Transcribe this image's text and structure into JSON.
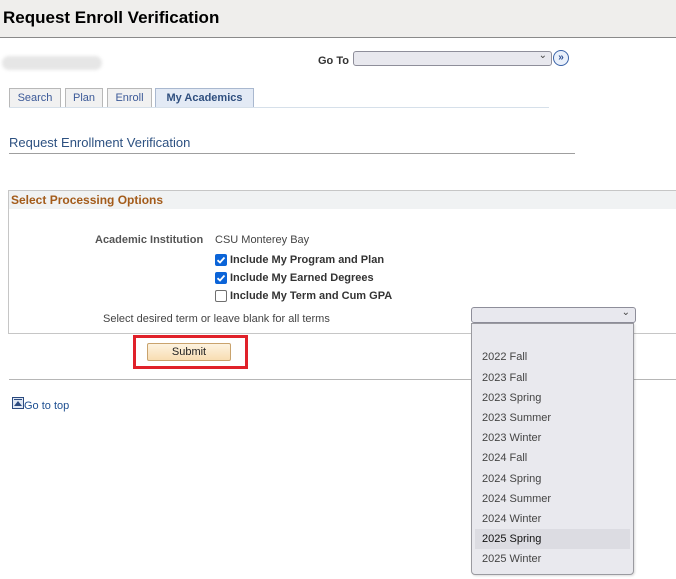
{
  "header": {
    "title": "Request Enroll Verification"
  },
  "goto": {
    "label": "Go To",
    "value": "",
    "go_button": "»"
  },
  "tabs": [
    {
      "label": "Search",
      "active": false
    },
    {
      "label": "Plan",
      "active": false
    },
    {
      "label": "Enroll",
      "active": false
    },
    {
      "label": "My Academics",
      "active": true
    }
  ],
  "page": {
    "section_title": "Request Enrollment Verification",
    "groupbox_title": "Select Processing Options",
    "institution_label": "Academic Institution",
    "institution_value": "CSU Monterey Bay",
    "options": [
      {
        "label": "Include My Program and Plan",
        "checked": true
      },
      {
        "label": "Include My Earned Degrees",
        "checked": true
      },
      {
        "label": "Include My Term and Cum GPA",
        "checked": false
      }
    ],
    "term_label": "Select desired term or leave blank for all terms",
    "term_value": "",
    "term_options": [
      "",
      "2022 Fall",
      "2023 Fall",
      "2023 Spring",
      "2023 Summer",
      "2023 Winter",
      "2024 Fall",
      "2024 Spring",
      "2024 Summer",
      "2024 Winter",
      "2025 Spring",
      "2025 Winter"
    ],
    "term_hover": "2025 Spring",
    "submit_label": "Submit",
    "go_to_top": "Go to top"
  },
  "colors": {
    "highlight": "#e0212a",
    "checkbox": "#0b64d8",
    "groupbox_title": "#a35b1a",
    "link": "#1d4f91"
  }
}
